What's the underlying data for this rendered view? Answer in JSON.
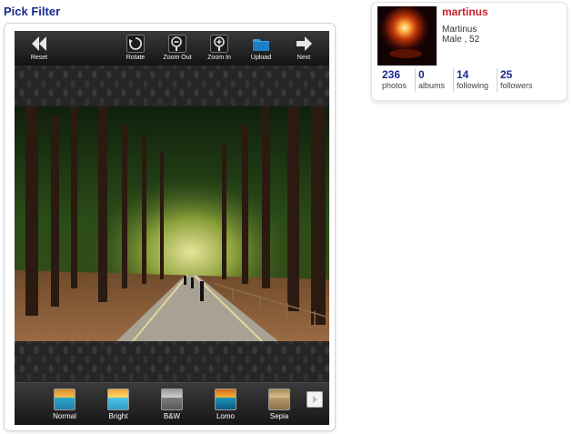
{
  "page": {
    "title": "Pick Filter"
  },
  "toolbar": {
    "reset_label": "Reset",
    "rotate_label": "Rotate",
    "zoom_out_label": "Zoom Out",
    "zoom_in_label": "Zoom In",
    "upload_label": "Upload",
    "next_label": "Next"
  },
  "filters": [
    {
      "label": "Normal"
    },
    {
      "label": "Bright"
    },
    {
      "label": "B&W"
    },
    {
      "label": "Lomo"
    },
    {
      "label": "Sepia"
    }
  ],
  "profile": {
    "username": "martinus",
    "real_name": "Martinus",
    "meta": "Male , 52",
    "stats": [
      {
        "value": "236",
        "label": "photos"
      },
      {
        "value": "0",
        "label": "albums"
      },
      {
        "value": "14",
        "label": "following"
      },
      {
        "value": "25",
        "label": "followers"
      }
    ]
  },
  "colors": {
    "title": "#1b2a8c",
    "username": "#cc1f2b",
    "stat_number": "#1b2a8c"
  }
}
